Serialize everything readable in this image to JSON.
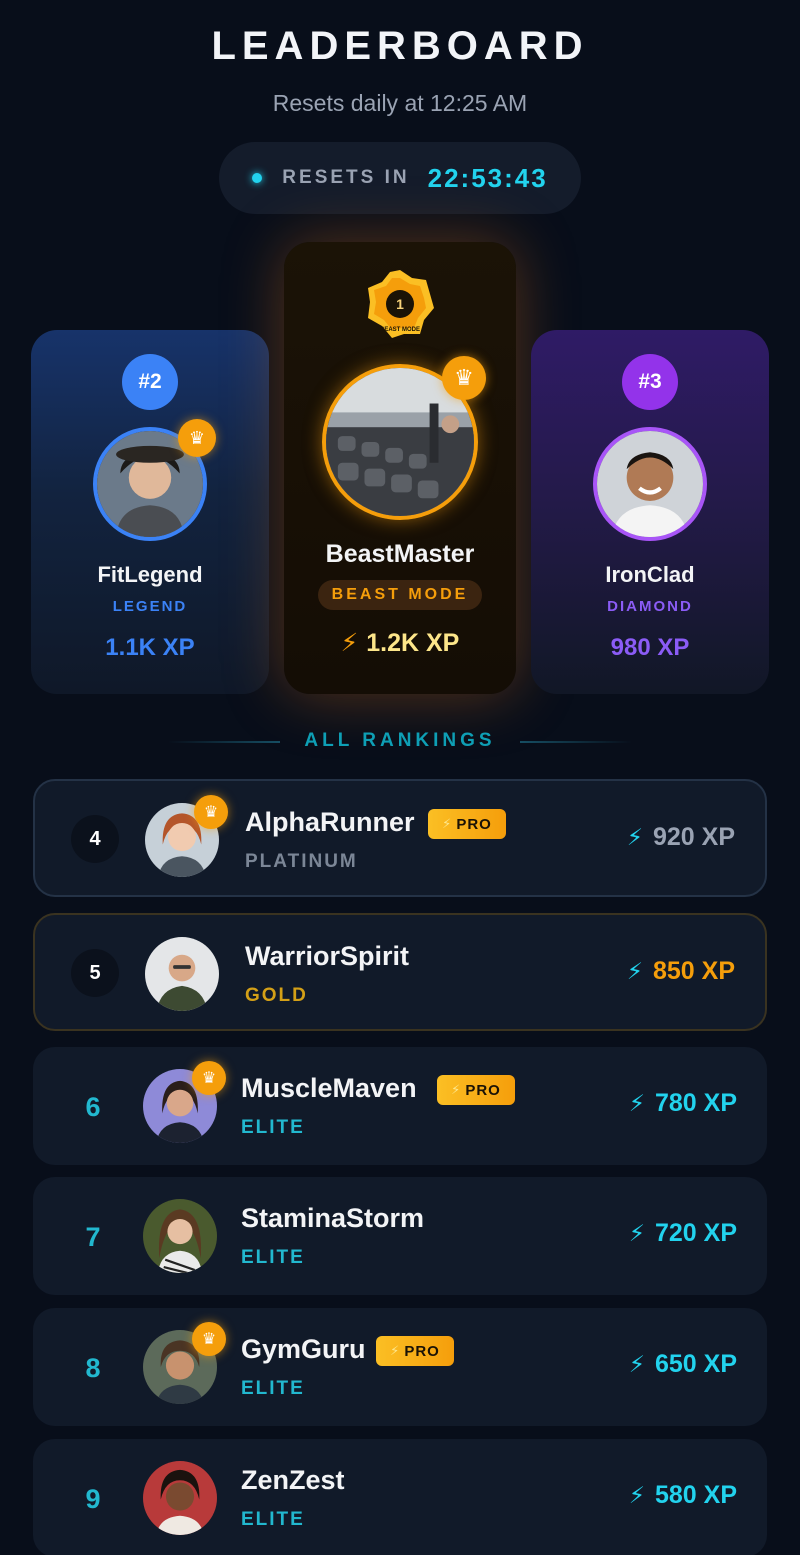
{
  "header": {
    "title": "LEADERBOARD",
    "subtitle": "Resets daily at 12:25 AM",
    "reset_label": "RESETS IN",
    "reset_time": "22:53:43"
  },
  "podium": {
    "first": {
      "name": "BeastMaster",
      "mode": "BEAST MODE",
      "xp": "1.2K XP",
      "medal_rank": "1",
      "medal_text": "BEAST MODE"
    },
    "second": {
      "rank": "#2",
      "name": "FitLegend",
      "tier": "LEGEND",
      "xp": "1.1K XP"
    },
    "third": {
      "rank": "#3",
      "name": "IronClad",
      "tier": "DIAMOND",
      "xp": "980 XP"
    }
  },
  "divider_label": "ALL RANKINGS",
  "rankings": [
    {
      "rank": "4",
      "name": "AlphaRunner",
      "tier": "PLATINUM",
      "xp": "920 XP",
      "pro": "PRO"
    },
    {
      "rank": "5",
      "name": "WarriorSpirit",
      "tier": "GOLD",
      "xp": "850 XP"
    },
    {
      "rank": "6",
      "name": "MuscleMaven",
      "tier": "ELITE",
      "xp": "780 XP",
      "pro": "PRO"
    },
    {
      "rank": "7",
      "name": "StaminaStorm",
      "tier": "ELITE",
      "xp": "720 XP"
    },
    {
      "rank": "8",
      "name": "GymGuru",
      "tier": "ELITE",
      "xp": "650 XP",
      "pro": "PRO"
    },
    {
      "rank": "9",
      "name": "ZenZest",
      "tier": "ELITE",
      "xp": "580 XP"
    }
  ],
  "colors": {
    "accent": "#22d3ee",
    "gold": "#f59e0b",
    "legend": "#3b82f6",
    "diamond": "#8b5cf6",
    "platinum": "#7b8696",
    "gold_tier": "#d4a017",
    "elite": "#22b8cf"
  },
  "icons": [
    "crown-icon",
    "bolt-icon",
    "medal-icon",
    "status-dot-icon"
  ]
}
